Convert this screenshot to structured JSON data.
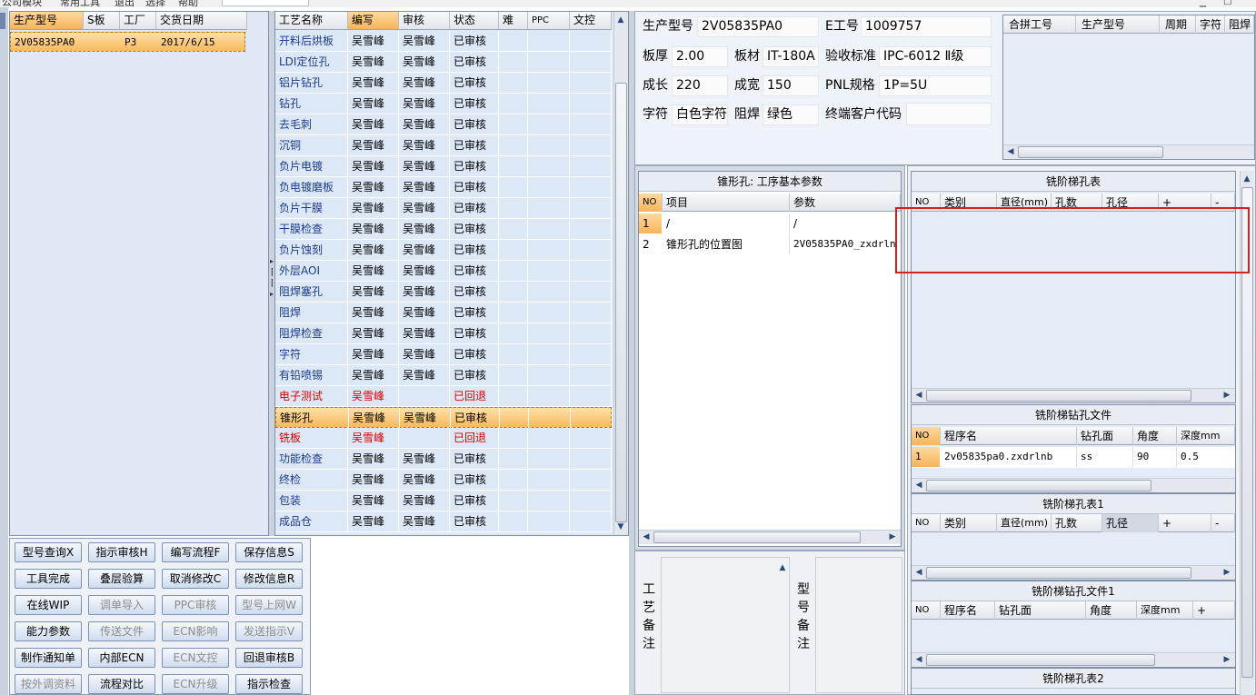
{
  "topbar": {
    "fragments": [
      "公司模块",
      "常用工具",
      "退出",
      "选择",
      "帮助"
    ]
  },
  "model_list": {
    "columns": [
      "生产型号",
      "S板",
      "工厂",
      "交货日期"
    ],
    "rows": [
      {
        "model": "2V05835PA0",
        "s": "",
        "factory": "P3",
        "date": "2017/6/15"
      }
    ]
  },
  "process_grid": {
    "columns": [
      "工艺名称",
      "编写",
      "审核",
      "状态",
      "难",
      "PPC",
      "文控"
    ],
    "rows": [
      {
        "name": "开料后烘板",
        "writer": "吴雪峰",
        "reviewer": "吴雪峰",
        "status": "已审核"
      },
      {
        "name": "LDI定位孔",
        "writer": "吴雪峰",
        "reviewer": "吴雪峰",
        "status": "已审核"
      },
      {
        "name": "铝片钻孔",
        "writer": "吴雪峰",
        "reviewer": "吴雪峰",
        "status": "已审核"
      },
      {
        "name": "钻孔",
        "writer": "吴雪峰",
        "reviewer": "吴雪峰",
        "status": "已审核"
      },
      {
        "name": "去毛刺",
        "writer": "吴雪峰",
        "reviewer": "吴雪峰",
        "status": "已审核"
      },
      {
        "name": "沉铜",
        "writer": "吴雪峰",
        "reviewer": "吴雪峰",
        "status": "已审核"
      },
      {
        "name": "负片电镀",
        "writer": "吴雪峰",
        "reviewer": "吴雪峰",
        "status": "已审核"
      },
      {
        "name": "负电镀磨板",
        "writer": "吴雪峰",
        "reviewer": "吴雪峰",
        "status": "已审核"
      },
      {
        "name": "负片干膜",
        "writer": "吴雪峰",
        "reviewer": "吴雪峰",
        "status": "已审核"
      },
      {
        "name": "干膜检查",
        "writer": "吴雪峰",
        "reviewer": "吴雪峰",
        "status": "已审核"
      },
      {
        "name": "负片蚀刻",
        "writer": "吴雪峰",
        "reviewer": "吴雪峰",
        "status": "已审核"
      },
      {
        "name": "外层AOI",
        "writer": "吴雪峰",
        "reviewer": "吴雪峰",
        "status": "已审核"
      },
      {
        "name": "阻焊塞孔",
        "writer": "吴雪峰",
        "reviewer": "吴雪峰",
        "status": "已审核"
      },
      {
        "name": "阻焊",
        "writer": "吴雪峰",
        "reviewer": "吴雪峰",
        "status": "已审核"
      },
      {
        "name": "阻焊检查",
        "writer": "吴雪峰",
        "reviewer": "吴雪峰",
        "status": "已审核"
      },
      {
        "name": "字符",
        "writer": "吴雪峰",
        "reviewer": "吴雪峰",
        "status": "已审核"
      },
      {
        "name": "有铅喷锡",
        "writer": "吴雪峰",
        "reviewer": "吴雪峰",
        "status": "已审核"
      },
      {
        "name": "电子测试",
        "writer": "吴雪峰",
        "reviewer": "",
        "status": "已回退",
        "red": true
      },
      {
        "name": "锥形孔",
        "writer": "吴雪峰",
        "reviewer": "吴雪峰",
        "status": "已审核",
        "current": true
      },
      {
        "name": "铣板",
        "writer": "吴雪峰",
        "reviewer": "",
        "status": "已回退",
        "red": true
      },
      {
        "name": "功能检查",
        "writer": "吴雪峰",
        "reviewer": "吴雪峰",
        "status": "已审核"
      },
      {
        "name": "终检",
        "writer": "吴雪峰",
        "reviewer": "吴雪峰",
        "status": "已审核"
      },
      {
        "name": "包装",
        "writer": "吴雪峰",
        "reviewer": "吴雪峰",
        "status": "已审核"
      },
      {
        "name": "成品仓",
        "writer": "吴雪峰",
        "reviewer": "吴雪峰",
        "status": "已审核"
      }
    ]
  },
  "buttons": [
    [
      "型号查询X",
      "指示审核H",
      "编写流程F",
      "保存信息S"
    ],
    [
      "工具完成",
      "叠层验算",
      "取消修改C",
      "修改信息R"
    ],
    [
      "在线WIP",
      "调单导入",
      "PPC审核",
      "型号上网W"
    ],
    [
      "能力参数",
      "传送文件",
      "ECN影响",
      "发送指示V"
    ],
    [
      "制作通知单",
      "内部ECN",
      "ECN文控",
      "回退审核B"
    ],
    [
      "按外调资料",
      "流程对比",
      "ECN升级",
      "指示检查"
    ]
  ],
  "disabled_buttons": [
    "调单导入",
    "PPC审核",
    "型号上网W",
    "传送文件",
    "ECN影响",
    "发送指示V",
    "ECN文控",
    "按外调资料",
    "ECN升级"
  ],
  "info": {
    "model_label": "生产型号",
    "model_value": "2V05835PA0",
    "eno_label": "E工号",
    "eno_value": "1009757",
    "thick_label": "板厚",
    "thick_value": "2.00",
    "material_label": "板材",
    "material_value": "IT-180A",
    "standard_label": "验收标准",
    "standard_value": "IPC-6012 Ⅱ级",
    "length_label": "成长",
    "length_value": "220",
    "width_label": "成宽",
    "width_value": "150",
    "pnl_label": "PNL规格",
    "pnl_value": "1P=5U",
    "char_label": "字符",
    "char_value": "白色字符",
    "mask_label": "阻焊",
    "mask_value": "绿色",
    "customer_label": "终端客户代码",
    "customer_value": ""
  },
  "merge_grid": {
    "columns": [
      "合拼工号",
      "生产型号",
      "周期",
      "字符",
      "阻焊"
    ]
  },
  "param_panel": {
    "title": "锥形孔: 工序基本参数",
    "columns": [
      "NO",
      "项目",
      "参数"
    ],
    "rows": [
      {
        "no": "1",
        "item": "/",
        "param": "/"
      },
      {
        "no": "2",
        "item": "锥形孔的位置图",
        "param": "2V05835PA0_zxdrln"
      }
    ]
  },
  "step_hole_table": {
    "title": "铣阶梯孔表",
    "columns": [
      "NO",
      "类别",
      "直径(mm)",
      "孔数",
      "孔径",
      "+",
      "-"
    ]
  },
  "step_drill_file": {
    "title": "铣阶梯钻孔文件",
    "columns": [
      "NO",
      "程序名",
      "钻孔面",
      "角度",
      "深度mm"
    ],
    "rows": [
      {
        "no": "1",
        "program": "2v05835pa0.zxdrlnb",
        "face": "ss",
        "angle": "90",
        "depth": "0.5"
      }
    ]
  },
  "step_hole_table1": {
    "title": "铣阶梯孔表1",
    "columns": [
      "NO",
      "类别",
      "直径(mm)",
      "孔数",
      "孔径",
      "+",
      "-"
    ]
  },
  "step_drill_file1": {
    "title": "铣阶梯钻孔文件1",
    "columns": [
      "NO",
      "程序名",
      "钻孔面",
      "角度",
      "深度mm",
      "+"
    ]
  },
  "step_hole_table2": {
    "title": "铣阶梯孔表2"
  },
  "notes": {
    "process_note": "工艺备注",
    "model_note": "型号备注"
  }
}
